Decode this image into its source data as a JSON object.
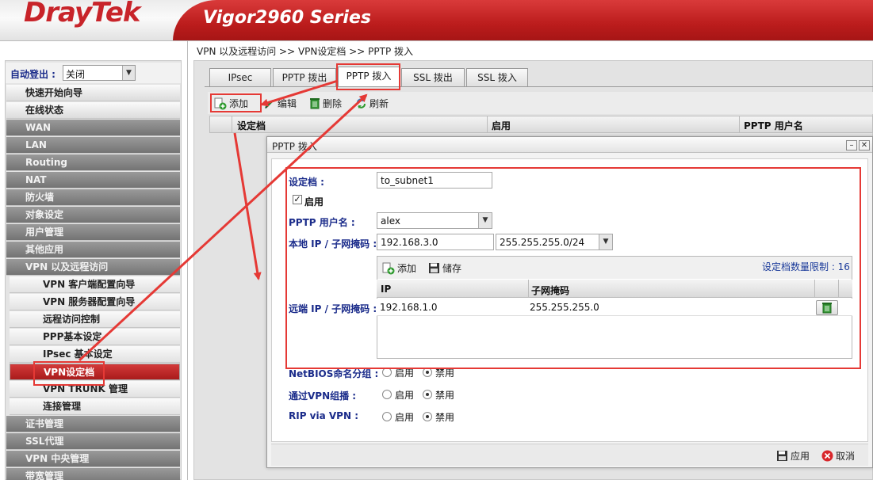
{
  "header": {
    "brand": "DrayTek",
    "series": "Vigor2960 Series"
  },
  "sidebar": {
    "auto_logout_label": "自动登出 :",
    "auto_logout_value": "关闭",
    "items": [
      {
        "label": "快速开始向导"
      },
      {
        "label": "在线状态"
      },
      {
        "label": "WAN"
      },
      {
        "label": "LAN"
      },
      {
        "label": "Routing"
      },
      {
        "label": "NAT"
      },
      {
        "label": "防火墙"
      },
      {
        "label": "对象设定"
      },
      {
        "label": "用户管理"
      },
      {
        "label": "其他应用"
      },
      {
        "label": "VPN 以及远程访问"
      },
      {
        "label": "VPN 客户端配置向导"
      },
      {
        "label": "VPN 服务器配置向导"
      },
      {
        "label": "远程访问控制"
      },
      {
        "label": "PPP基本设定"
      },
      {
        "label": "IPsec 基本设定"
      },
      {
        "label": "VPN设定档"
      },
      {
        "label": "VPN TRUNK 管理"
      },
      {
        "label": "连接管理"
      },
      {
        "label": "证书管理"
      },
      {
        "label": "SSL代理"
      },
      {
        "label": "VPN 中央管理"
      },
      {
        "label": "带宽管理"
      }
    ]
  },
  "breadcrumb": "VPN 以及远程访问 >> VPN设定档 >> PPTP 拨入",
  "tabs": [
    "IPsec",
    "PPTP 拨出",
    "PPTP 拨入",
    "SSL 拨出",
    "SSL 拨入"
  ],
  "toolbar": {
    "add": "添加",
    "edit": "编辑",
    "delete": "删除",
    "refresh": "刷新"
  },
  "grid_headers": [
    "设定档",
    "启用",
    "PPTP 用户名"
  ],
  "dialog": {
    "title": "PPTP 拨入",
    "profile_label": "设定档 :",
    "profile_value": "to_subnet1",
    "enable_label": "启用",
    "pptp_user_label": "PPTP 用户名 :",
    "pptp_user_value": "alex",
    "local_ip_label": "本地 IP / 子网掩码 :",
    "local_ip_value": "192.168.3.0",
    "local_mask_value": "255.255.255.0/24",
    "remote_label": "远端 IP / 子网掩码 :",
    "remote_add": "添加",
    "remote_save": "储存",
    "profile_limit": "设定档数量限制 : 16",
    "remote_col_ip": "IP",
    "remote_col_mask": "子网掩码",
    "remote_row_ip": "192.168.1.0",
    "remote_row_mask": "255.255.255.0",
    "netbios_label": "NetBIOS命名分组 :",
    "via_vpn_label": "通过VPN组播 :",
    "rip_label": "RIP via VPN :",
    "opt_enable": "启用",
    "opt_disable": "禁用",
    "apply": "应用",
    "cancel": "取消"
  },
  "colors": {
    "brand_red": "#c8242a",
    "annotation_red": "#e53935",
    "label_blue": "#1a2b8a"
  }
}
